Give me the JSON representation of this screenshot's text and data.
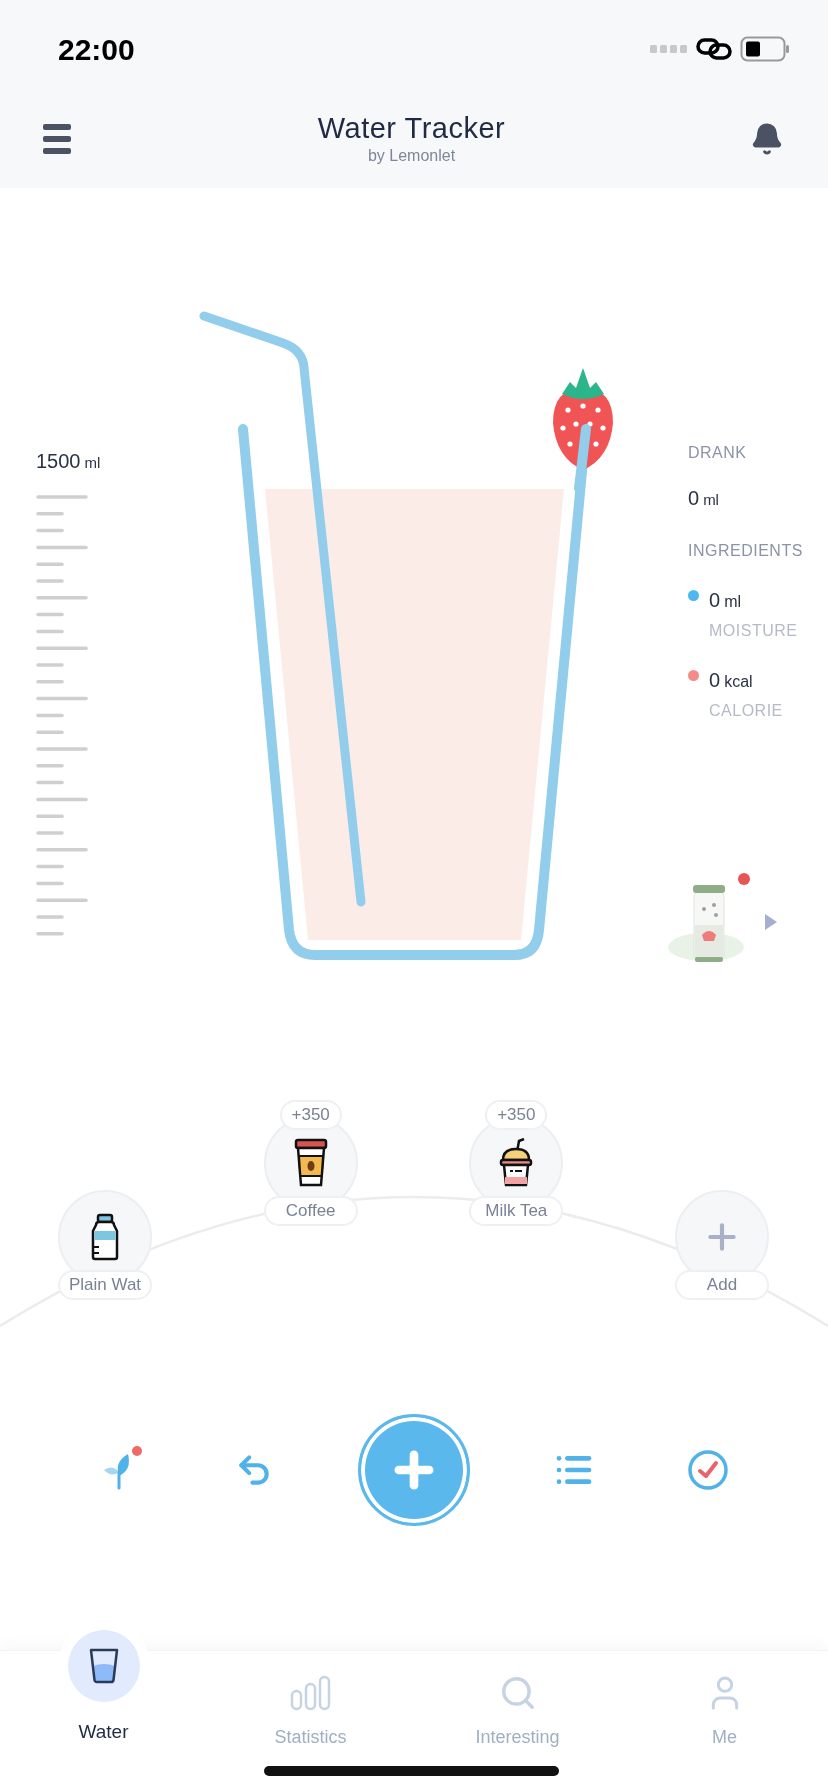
{
  "status_bar": {
    "time": "22:00"
  },
  "header": {
    "title": "Water Tracker",
    "subtitle": "by Lemonlet"
  },
  "scale": {
    "value": "1500",
    "unit": "ml"
  },
  "stats": {
    "drank_label": "DRANK",
    "drank": {
      "value": "0",
      "unit": "ml"
    },
    "ingredients_label": "INGREDIENTS",
    "ingredients": [
      {
        "value": "0",
        "unit": "ml",
        "label": "MOISTURE",
        "color": "#4db8ee"
      },
      {
        "value": "0",
        "unit": "kcal",
        "label": "CALORIE",
        "color": "#f58c8c"
      }
    ]
  },
  "reward": {
    "dot": true
  },
  "drinks": [
    {
      "kind": "water",
      "name": "Plain Wat"
    },
    {
      "kind": "coffee",
      "name": "Coffee",
      "badge": "+350"
    },
    {
      "kind": "milk_tea",
      "name": "Milk Tea",
      "badge": "+350"
    },
    {
      "kind": "add",
      "name": "Add"
    }
  ],
  "toolbar": [
    {
      "kind": "sprout",
      "dot": true
    },
    {
      "kind": "undo"
    },
    {
      "kind": "add"
    },
    {
      "kind": "list"
    },
    {
      "kind": "check"
    }
  ],
  "tabs": [
    {
      "kind": "water",
      "label": "Water",
      "selected": true
    },
    {
      "kind": "statistics",
      "label": "Statistics",
      "selected": false
    },
    {
      "kind": "interesting",
      "label": "Interesting",
      "selected": false
    },
    {
      "kind": "me",
      "label": "Me",
      "selected": false
    }
  ]
}
